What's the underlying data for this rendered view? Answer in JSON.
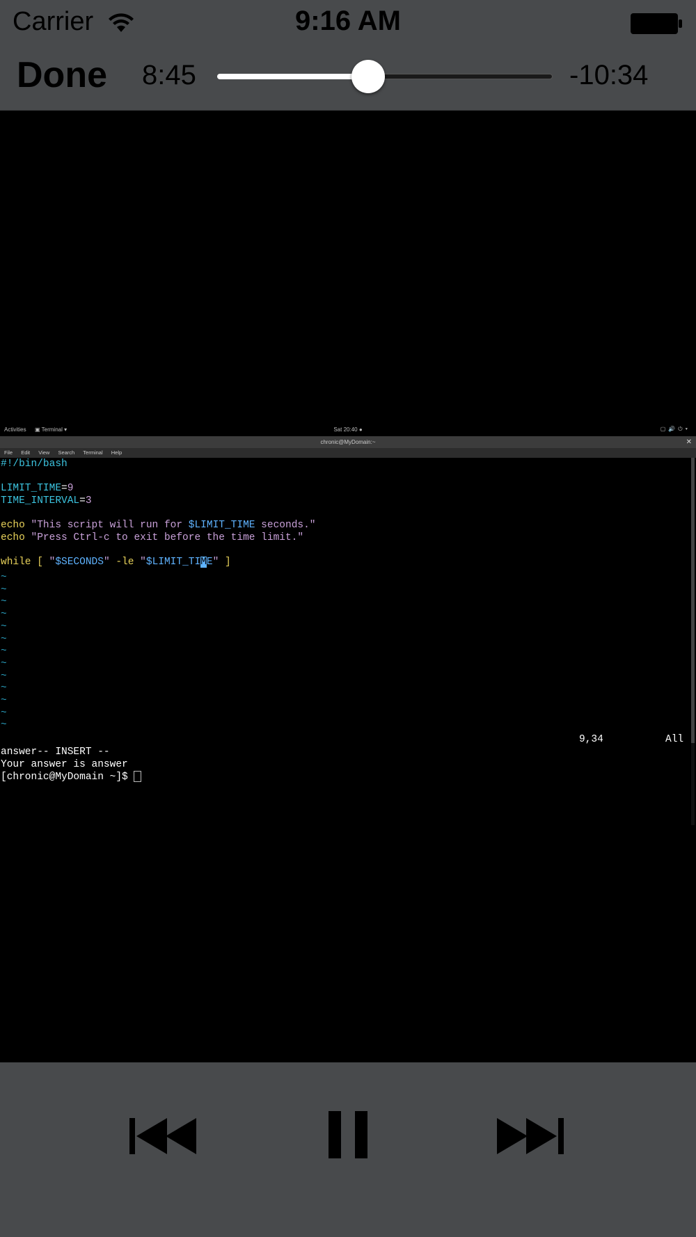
{
  "status_bar": {
    "carrier": "Carrier",
    "time": "9:16 AM"
  },
  "player": {
    "done_label": "Done",
    "elapsed": "8:45",
    "remaining": "-10:34",
    "progress": 0.45
  },
  "gnome_bar": {
    "activities": "Activities",
    "app_menu": "Terminal",
    "clock": "Sat 20:40"
  },
  "terminal": {
    "title": "chronic@MyDomain:~",
    "menu": [
      "File",
      "Edit",
      "View",
      "Search",
      "Terminal",
      "Help"
    ],
    "script": {
      "shebang": "#!/bin/bash",
      "limit_var": "LIMIT_TIME",
      "limit_val": "9",
      "interval_var": "TIME_INTERVAL",
      "interval_val": "3",
      "echo_cmd": "echo",
      "echo1_a": "\"This script will run for ",
      "echo1_var": "$LIMIT_TIME",
      "echo1_b": " seconds.\"",
      "echo2": "\"Press Ctrl-c to exit before the time limit.\"",
      "while_kw": "while",
      "while_open": " [ ",
      "q1": "\"",
      "seconds_var": "$SECONDS",
      "q2": "\"",
      "le": " -le ",
      "q3": "\"",
      "limit_a": "$LIMIT_TI",
      "limit_caret": "M",
      "limit_b": "E",
      "q4": "\"",
      "while_close": " ]"
    },
    "tilde": "~",
    "mode": "-- INSERT --",
    "position": "9,34",
    "scroll": "All",
    "output_1": "answer",
    "output_2": "Your answer is answer",
    "prompt": "[chronic@MyDomain ~]$ "
  }
}
